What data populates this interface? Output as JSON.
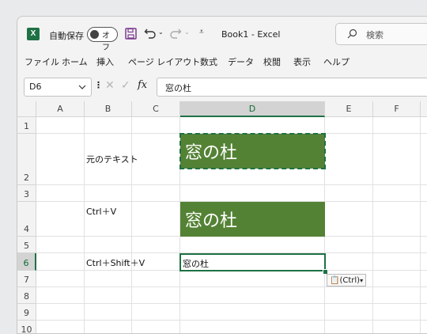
{
  "titlebar": {
    "app_icon": "X",
    "autosave_label": "自動保存",
    "autosave_state": "オフ",
    "doc_title": "Book1  -  Excel",
    "search_placeholder": "検索"
  },
  "menu": [
    "ファイル",
    "ホーム",
    "挿入",
    "ページ レイアウト",
    "数式",
    "データ",
    "校閲",
    "表示",
    "ヘルプ"
  ],
  "formula_bar": {
    "name_box": "D6",
    "fx": "fx",
    "content": "窓の杜"
  },
  "columns": [
    "A",
    "B",
    "C",
    "D",
    "E",
    "F"
  ],
  "selected_column": "D",
  "rows": [
    "1",
    "2",
    "3",
    "4",
    "5",
    "6",
    "7",
    "8",
    "9",
    "10"
  ],
  "selected_row": "6",
  "cells": {
    "B2": "元のテキスト",
    "D2": "窓の杜",
    "B4": "Ctrl＋V",
    "D4": "窓の杜",
    "B6": "Ctrl＋Shift＋V",
    "D6": "窓の杜"
  },
  "paste_options": "(Ctrl)",
  "colors": {
    "excel_green": "#1e7145",
    "fill_green": "#548235"
  }
}
